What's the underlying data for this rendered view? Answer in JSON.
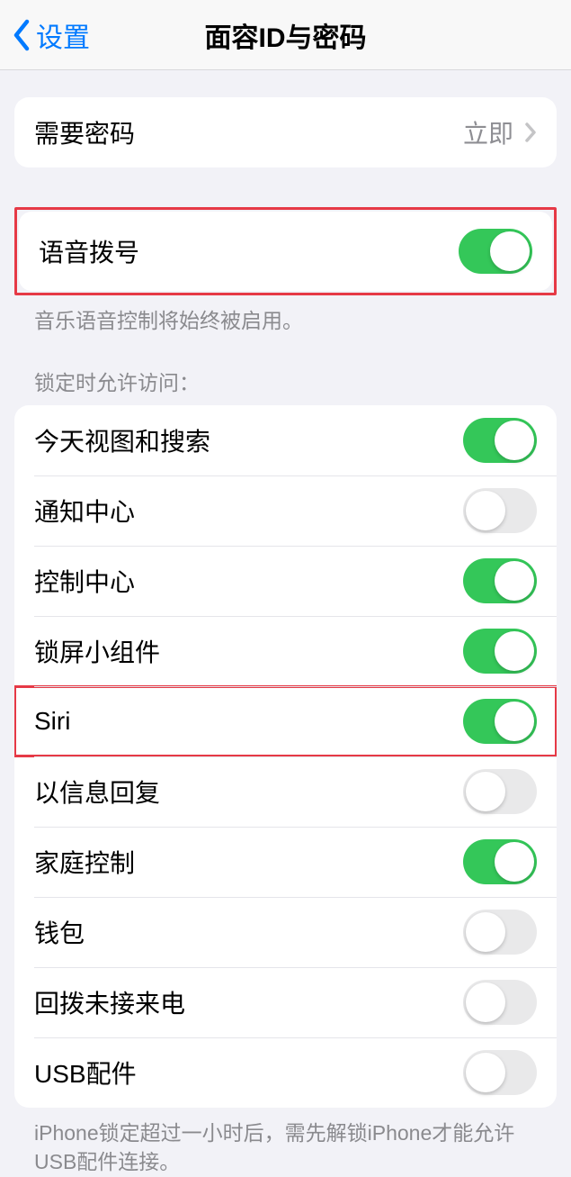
{
  "header": {
    "back_label": "设置",
    "title": "面容ID与密码"
  },
  "passcode_row": {
    "label": "需要密码",
    "value": "立即"
  },
  "voice_dial": {
    "label": "语音拨号",
    "on": true,
    "footer": "音乐语音控制将始终被启用。"
  },
  "lock_access": {
    "header": "锁定时允许访问：",
    "items": [
      {
        "label": "今天视图和搜索",
        "on": true
      },
      {
        "label": "通知中心",
        "on": false
      },
      {
        "label": "控制中心",
        "on": true
      },
      {
        "label": "锁屏小组件",
        "on": true
      },
      {
        "label": "Siri",
        "on": true
      },
      {
        "label": "以信息回复",
        "on": false
      },
      {
        "label": "家庭控制",
        "on": true
      },
      {
        "label": "钱包",
        "on": false
      },
      {
        "label": "回拨未接来电",
        "on": false
      },
      {
        "label": "USB配件",
        "on": false
      }
    ],
    "footer": "iPhone锁定超过一小时后，需先解锁iPhone才能允许USB配件连接。"
  },
  "highlights": [
    0,
    4
  ]
}
